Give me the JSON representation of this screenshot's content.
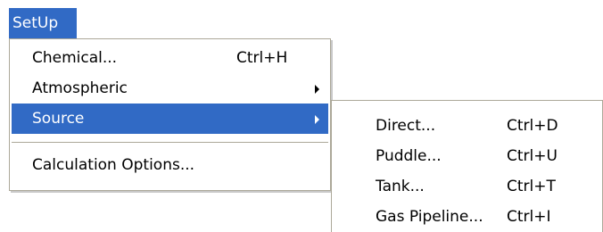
{
  "menubar": {
    "title": "SetUp"
  },
  "setup_menu": {
    "items": [
      {
        "label": "Chemical...",
        "shortcut": "Ctrl+H"
      },
      {
        "label": "Atmospheric",
        "shortcut": ""
      },
      {
        "label": "Source",
        "shortcut": ""
      },
      {
        "label": "Calculation Options...",
        "shortcut": ""
      }
    ]
  },
  "source_submenu": {
    "items": [
      {
        "label": "Direct...",
        "shortcut": "Ctrl+D"
      },
      {
        "label": "Puddle...",
        "shortcut": "Ctrl+U"
      },
      {
        "label": "Tank...",
        "shortcut": "Ctrl+T"
      },
      {
        "label": "Gas Pipeline...",
        "shortcut": "Ctrl+I"
      }
    ]
  },
  "colors": {
    "highlight": "#316ac5",
    "menu_border": "#aca899"
  }
}
